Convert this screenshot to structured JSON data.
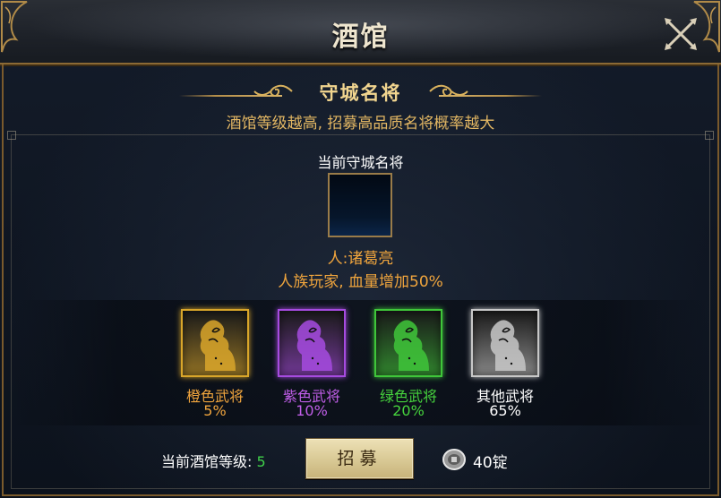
{
  "window": {
    "title": "酒馆"
  },
  "section": {
    "title": "守城名将",
    "subtitle": "酒馆等级越高, 招募高品质名将概率越大"
  },
  "current": {
    "label": "当前守城名将",
    "hero_name": "人:诸葛亮",
    "hero_effect": "人族玩家, 血量增加50%"
  },
  "rarities": [
    {
      "label": "橙色武将",
      "rate": "5%",
      "color": "#f0a53d",
      "frame": "#d9a62a"
    },
    {
      "label": "紫色武将",
      "rate": "10%",
      "color": "#c05ee8",
      "frame": "#a64be0"
    },
    {
      "label": "绿色武将",
      "rate": "20%",
      "color": "#46d33d",
      "frame": "#3fc63a"
    },
    {
      "label": "其他武将",
      "rate": "65%",
      "color": "#ffffff",
      "frame": "#c8c8c8"
    }
  ],
  "footer": {
    "level_label": "当前酒馆等级: ",
    "level_value": "5",
    "recruit_button": "招募",
    "cost": "40锭"
  },
  "icons": {
    "close": "close-x-icon",
    "coin": "silver-coin-icon",
    "ornament": "gold-cloud-ornament-icon",
    "silhouette": "warrior-silhouette-icon"
  }
}
